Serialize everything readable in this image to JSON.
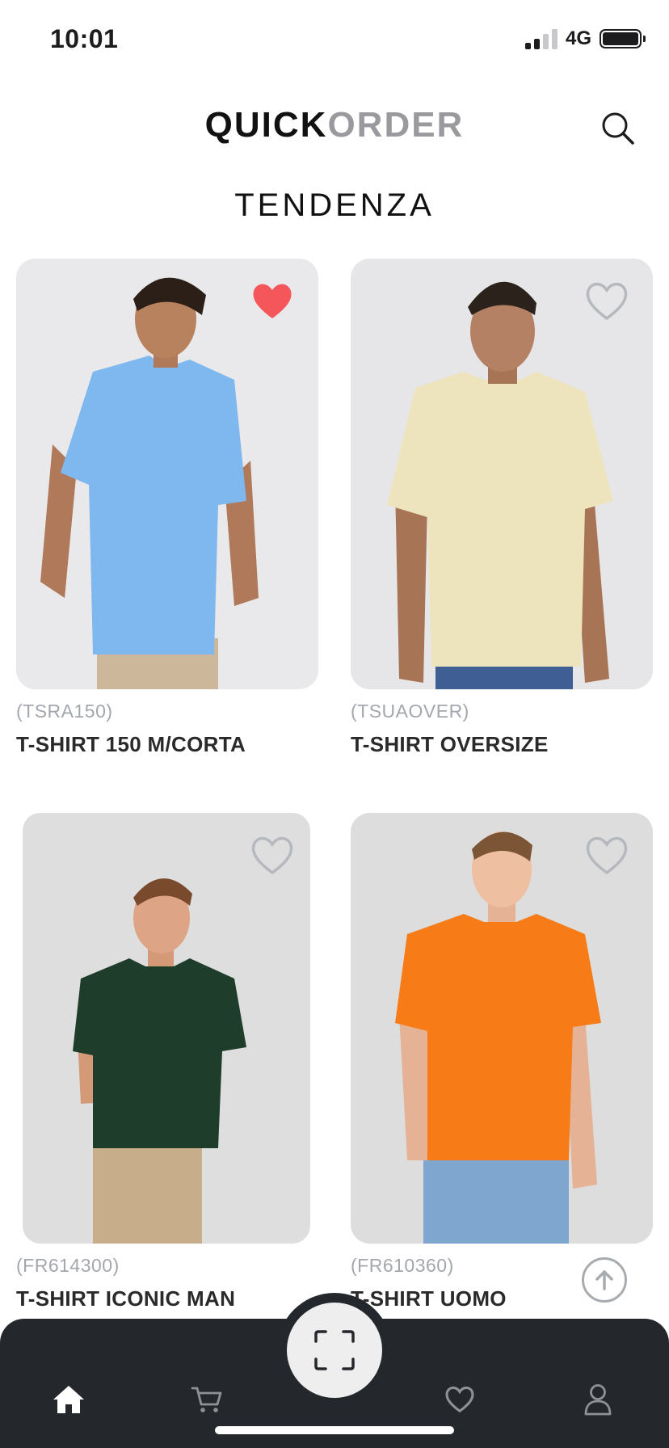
{
  "status_bar": {
    "time": "10:01",
    "network": "4G"
  },
  "header": {
    "logo_part1": "QUICK",
    "logo_part2": "ORDER"
  },
  "section_title": "TENDENZA",
  "products": [
    {
      "code": "(TSRA150)",
      "name": "T-SHIRT 150 M/CORTA",
      "favorite": true,
      "shirt_color": "#7fb8ee"
    },
    {
      "code": "(TSUAOVER)",
      "name": "T-SHIRT OVERSIZE",
      "favorite": false,
      "shirt_color": "#ede3bd"
    },
    {
      "code": "(FR614300)",
      "name": "T-SHIRT ICONIC MAN",
      "favorite": false,
      "shirt_color": "#1e3d2a"
    },
    {
      "code": "(FR610360)",
      "name": "T-SHIRT UOMO",
      "favorite": false,
      "shirt_color": "#f77c18"
    }
  ],
  "colors": {
    "favorite_active": "#f4565a",
    "favorite_inactive": "#b5b9be",
    "tab_bar": "#24272b"
  },
  "tab_bar": {
    "items": [
      {
        "icon": "home-icon",
        "active": true
      },
      {
        "icon": "cart-icon",
        "active": false
      },
      {
        "icon": "scan-icon",
        "active": false
      },
      {
        "icon": "heart-icon",
        "active": false
      },
      {
        "icon": "user-icon",
        "active": false
      }
    ]
  }
}
